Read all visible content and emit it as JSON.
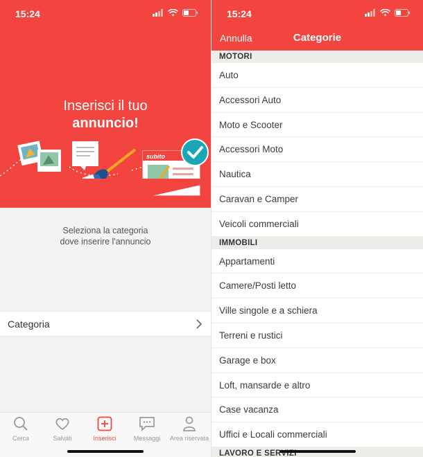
{
  "status": {
    "time": "15:24"
  },
  "left": {
    "hero_line1": "Inserisci il tuo",
    "hero_line2": "annuncio!",
    "logo_text": "subito",
    "subtitle_line1": "Seleziona la categoria",
    "subtitle_line2": "dove inserire l'annuncio",
    "category_label": "Categoria",
    "tabs": [
      {
        "label": "Cerca",
        "icon": "search-icon"
      },
      {
        "label": "Salvati",
        "icon": "heart-icon"
      },
      {
        "label": "Inserisci",
        "icon": "plus-square-icon"
      },
      {
        "label": "Messaggi",
        "icon": "chat-icon"
      },
      {
        "label": "Area riservata",
        "icon": "person-icon"
      }
    ],
    "active_tab": "Inserisci"
  },
  "right": {
    "cancel_label": "Annulla",
    "title": "Categorie",
    "sections": [
      {
        "name": "MOTORI",
        "items": [
          "Auto",
          "Accessori Auto",
          "Moto e Scooter",
          "Accessori Moto",
          "Nautica",
          "Caravan e Camper",
          "Veicoli commerciali"
        ]
      },
      {
        "name": "IMMOBILI",
        "items": [
          "Appartamenti",
          "Camere/Posti letto",
          "Ville singole e a schiera",
          "Terreni e rustici",
          "Garage e box",
          "Loft, mansarde e altro",
          "Case vacanza",
          "Uffici e Locali commerciali"
        ]
      },
      {
        "name": "LAVORO E SERVIZI",
        "items": []
      }
    ]
  },
  "colors": {
    "accent": "#f3453f",
    "background": "#f4f3f1",
    "section_bg": "#efedea",
    "check": "#1aa6b7"
  }
}
